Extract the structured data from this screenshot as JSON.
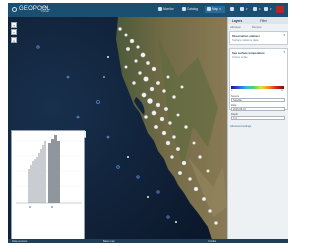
{
  "app": {
    "logo_text": "GEOPOOL",
    "logo_sub_line1": "Data",
    "logo_sub_line2": "Portal"
  },
  "nav": {
    "items": [
      {
        "label": "Monitor",
        "icon": "monitor-icon"
      },
      {
        "label": "Catalog",
        "icon": "catalog-icon"
      },
      {
        "label": "Map",
        "icon": "map-icon"
      },
      {
        "label": "Help",
        "icon": "help-icon"
      }
    ]
  },
  "map": {
    "zoom_in": "+",
    "zoom_out": "−",
    "home": "⌂"
  },
  "panel": {
    "tabs": [
      "Layers",
      "Filter"
    ],
    "sub_links": [
      "Add layer",
      "Remove"
    ],
    "layer1_title": "Observation stations",
    "layer1_sub": "Surface stations data",
    "layer2_title": "Sea surface temperature",
    "layer2_sub": "Colour scale",
    "legend_min": "0",
    "legend_max": "30",
    "fields": [
      {
        "label": "Source",
        "value": "Satellite"
      },
      {
        "label": "Date",
        "value": "2016-05-01"
      },
      {
        "label": "Depth",
        "value": "0 m"
      }
    ],
    "footer_link": "Advanced settings"
  },
  "timeseries": {
    "search_value": "Station search",
    "search_button": "⌕",
    "station_line1": "Station ID",
    "station_line2": "Monterey Bay",
    "station_link": "Details",
    "chart_title": "Observations"
  },
  "status": {
    "left": "Data sources",
    "middle": "Base map",
    "right": "Credits"
  },
  "colors": {
    "topbar": "#1b4f72",
    "panel_bg": "#eef1f4",
    "accent": "#2e6da4",
    "flag": "#b02828"
  }
}
